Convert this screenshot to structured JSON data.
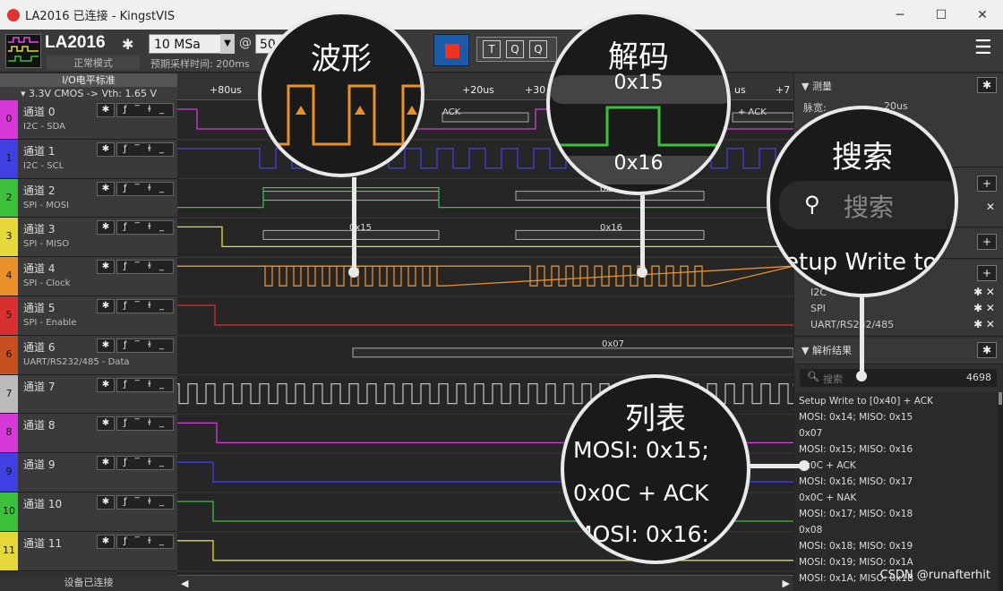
{
  "window": {
    "title": "LA2016 已连接 - KingstVIS",
    "minimize": "─",
    "maximize": "☐",
    "close": "✕"
  },
  "toolbar": {
    "device_name": "LA2016",
    "device_mode": "正常模式",
    "sample_rate": "10 MSa",
    "at_symbol": "@",
    "depth": "50",
    "sample_time": "预期采样时间: 200ms",
    "tools": [
      "T",
      "Q",
      "Q"
    ]
  },
  "io_panel": {
    "title": "I/O电平标准",
    "level": "▾ 3.3V CMOS -> Vth: 1.65 V"
  },
  "channels": [
    {
      "id": "0",
      "name": "通道 0",
      "sub": "I2C - SDA",
      "color": "#d63ad6"
    },
    {
      "id": "1",
      "name": "通道 1",
      "sub": "I2C - SCL",
      "color": "#4040e0"
    },
    {
      "id": "2",
      "name": "通道 2",
      "sub": "SPI - MOSI",
      "color": "#3cc03c"
    },
    {
      "id": "3",
      "name": "通道 3",
      "sub": "SPI - MISO",
      "color": "#e6d83a"
    },
    {
      "id": "4",
      "name": "通道 4",
      "sub": "SPI - Clock",
      "color": "#e8912a"
    },
    {
      "id": "5",
      "name": "通道 5",
      "sub": "SPI - Enable",
      "color": "#d83030"
    },
    {
      "id": "6",
      "name": "通道 6",
      "sub": "UART/RS232/485 - Data",
      "color": "#c85020"
    },
    {
      "id": "7",
      "name": "通道 7",
      "sub": "",
      "color": "#bbbbbb"
    },
    {
      "id": "8",
      "name": "通道 8",
      "sub": "",
      "color": "#d63ad6"
    },
    {
      "id": "9",
      "name": "通道 9",
      "sub": "",
      "color": "#4040e0"
    },
    {
      "id": "10",
      "name": "通道 10",
      "sub": "",
      "color": "#3cc03c"
    },
    {
      "id": "11",
      "name": "通道 11",
      "sub": "",
      "color": "#e6d83a"
    }
  ],
  "channel_tools": {
    "gear": "✱",
    "edges": "ƒ ‾ ɫ _"
  },
  "device_status": "设备已连接",
  "timeline": {
    "ticks": [
      "+80us",
      "+20us",
      "+30",
      "us",
      "+7"
    ]
  },
  "wave_labels": {
    "i2c_ack": "ACK",
    "i2c_ack2": "+ ACK",
    "mosi_a": "0x0",
    "miso_a": "0x15",
    "miso_b": "0x16",
    "uart": "0x07"
  },
  "right_panel": {
    "measure_title": "▼ 测量",
    "pulse_width_label": "脉宽:",
    "pulse_width_value": "20us",
    "analyzers": [
      "I2C",
      "SPI",
      "UART/RS232/485"
    ],
    "results_title": "▼ 解析结果",
    "search_placeholder": "搜索",
    "result_count": "4698",
    "results": [
      "Setup Write to [0x40] + ACK",
      "MOSI: 0x14;  MISO: 0x15",
      "0x07",
      "MOSI: 0x15;  MISO: 0x16",
      "0x0C + ACK",
      "MOSI: 0x16;  MISO: 0x17",
      "0x0C + NAK",
      "MOSI: 0x17;  MISO: 0x18",
      "0x08",
      "MOSI: 0x18;  MISO: 0x19",
      "MOSI: 0x19;  MISO: 0x1A",
      "MOSI: 0x1A;  MISO: 0x1B"
    ]
  },
  "callouts": {
    "waveform": "波形",
    "decode": "解码",
    "decode_top": "0x15",
    "decode_bottom": "0x16",
    "search": "搜索",
    "search_ph": "搜索",
    "search_text": "etup Write to",
    "list": "列表",
    "list_1": "MOSI: 0x15;",
    "list_2": "0x0C + ACK",
    "list_3": "MOSI: 0x16:"
  },
  "watermark": "CSDN @runafterhit"
}
